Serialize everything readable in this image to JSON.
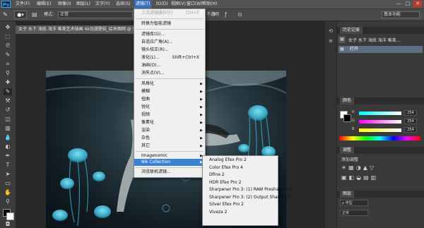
{
  "app": {
    "logo": "Ps"
  },
  "menubar": {
    "items": [
      "文件(F)",
      "编辑(E)",
      "图像(I)",
      "图层(L)",
      "文字(Y)",
      "选择(S)",
      "滤镜(T)",
      "3D(D)",
      "视图(V)",
      "窗口(W)",
      "帮助(H)"
    ],
    "window_controls": [
      "—",
      "□",
      "✕"
    ]
  },
  "options": {
    "mode_label": "模式:",
    "mode_value": "正常",
    "opacity_label": "不透明",
    "workspace": "基本功能"
  },
  "document": {
    "tab_title": "女子 水下 海底 海洋 唯美艺术插画 4k动漫壁纸_绘来图网 @ 50%(RGB/8#) *"
  },
  "filter_menu": {
    "items": [
      {
        "label": "上次滤镜操作(F)",
        "shortcut": "Ctrl+F",
        "disabled": true
      },
      {
        "sep": true
      },
      {
        "label": "转换为智能滤镜"
      },
      {
        "sep": true
      },
      {
        "label": "滤镜库(G)..."
      },
      {
        "label": "自适应广角(A)..."
      },
      {
        "label": "镜头校正(R)..."
      },
      {
        "label": "液化(L)...",
        "shortcut": "Shift+Ctrl+X"
      },
      {
        "label": "油画(O)..."
      },
      {
        "label": "消失点(V)..."
      },
      {
        "sep": true
      },
      {
        "label": "风格化",
        "submenu": true
      },
      {
        "label": "模糊",
        "submenu": true
      },
      {
        "label": "扭曲",
        "submenu": true
      },
      {
        "label": "锐化",
        "submenu": true
      },
      {
        "label": "视频",
        "submenu": true
      },
      {
        "label": "像素化",
        "submenu": true
      },
      {
        "label": "渲染",
        "submenu": true
      },
      {
        "label": "杂色",
        "submenu": true
      },
      {
        "label": "其它",
        "submenu": true
      },
      {
        "sep": true
      },
      {
        "label": "Imagenomic",
        "submenu": true
      },
      {
        "label": "Nik Collection",
        "submenu": true,
        "highlighted": true
      },
      {
        "sep": true
      },
      {
        "label": "浏览联机滤镜..."
      }
    ]
  },
  "nik_menu": {
    "items": [
      "Analog Efex Pro 2",
      "Color Efex Pro 4",
      "Dfine 2",
      "HDR Efex Pro 2",
      "Sharpener Pro 3: (1) RAW Presharpener",
      "Sharpener Pro 3: (2) Output Sharpener",
      "Silver Efex Pro 2",
      "Viveza 2"
    ]
  },
  "history_panel": {
    "tab_label": "历史记录",
    "snapshot_label": "女子 水下 海底 海洋 唯美...",
    "open_label": "打开"
  },
  "color_panel": {
    "tab_label": "颜色",
    "r_label": "R",
    "g_label": "G",
    "b_label": "B",
    "r_value": "254",
    "g_value": "254",
    "b_value": "254"
  },
  "adjust_panel": {
    "tab_label": "调整",
    "add_label": "添加调整"
  },
  "layers_panel": {
    "tab_label": "图层",
    "blend": "正常"
  },
  "colors": {
    "menu_highlight": "#3b82d6",
    "accent_blue": "#3d6fb8",
    "jelly": "#3aa7c4"
  },
  "icons": {
    "tools": [
      "move-icon",
      "marquee-icon",
      "lasso-icon",
      "quick-select-icon",
      "crop-icon",
      "eyedropper-icon",
      "healing-icon",
      "brush-icon",
      "stamp-icon",
      "history-brush-icon",
      "eraser-icon",
      "gradient-icon",
      "blur-icon",
      "dodge-icon",
      "pen-icon",
      "type-icon",
      "path-select-icon",
      "shape-icon",
      "hand-icon",
      "zoom-icon"
    ]
  }
}
